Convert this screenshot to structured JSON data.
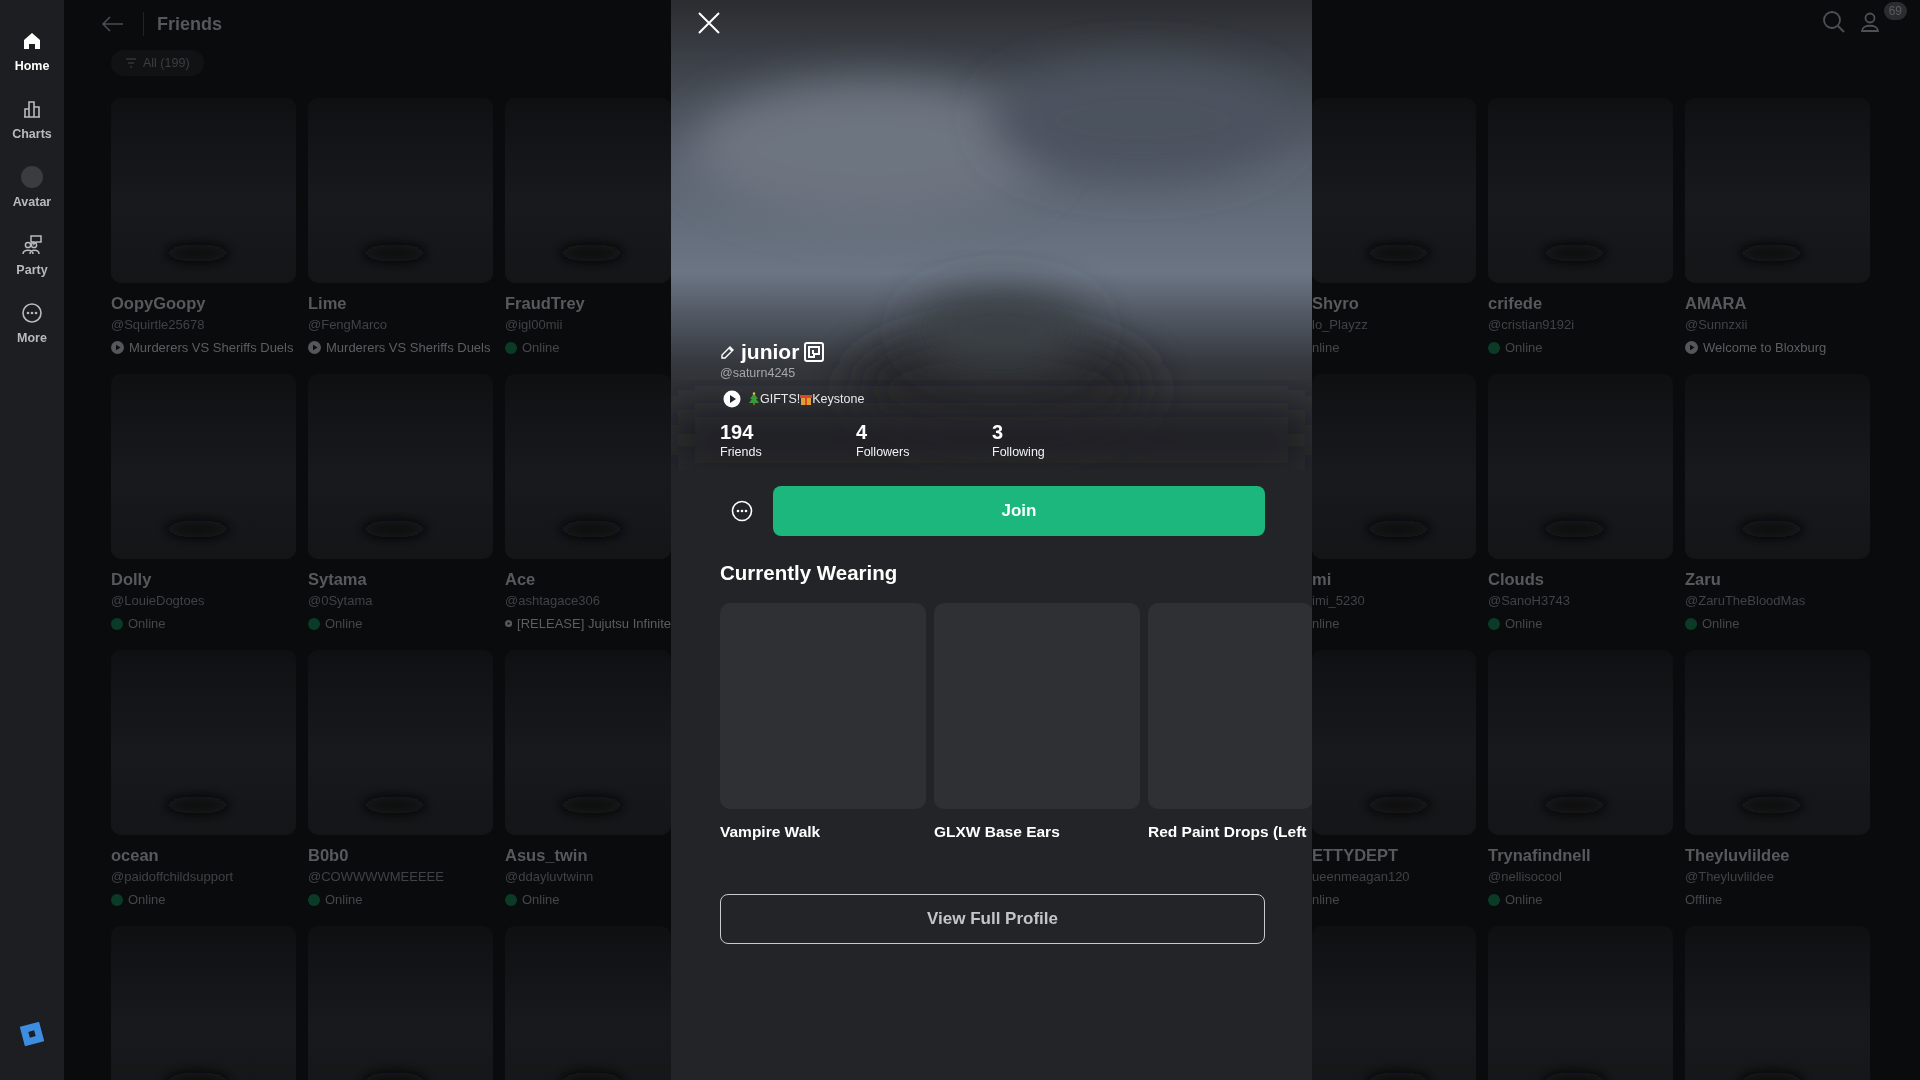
{
  "sidebar": {
    "items": [
      {
        "label": "Home",
        "selected": true
      },
      {
        "label": "Charts",
        "selected": false
      },
      {
        "label": "Avatar",
        "selected": false
      },
      {
        "label": "Party",
        "selected": false
      },
      {
        "label": "More",
        "selected": false
      }
    ]
  },
  "header": {
    "title": "Friends",
    "filter": "All (199)",
    "notifications": "69"
  },
  "friend_rows": [
    {
      "cards": [
        {
          "name": "OopyGoopy",
          "handle": "@Squirtle25678",
          "status": "Murderers VS Sheriffs Duels",
          "kind": "game"
        },
        {
          "name": "Lime",
          "handle": "@FengMarco",
          "status": "Murderers VS Sheriffs Duels",
          "kind": "game"
        },
        {
          "name": "FraudTrey",
          "handle": "@igl00mii",
          "status": "Online",
          "kind": "online"
        },
        {
          "name": "Shyro",
          "handle": "lo_Playzz",
          "status": "nline",
          "kind": "text"
        },
        {
          "name": "crifede",
          "handle": "@cristian9192i",
          "status": "Online",
          "kind": "online"
        },
        {
          "name": "AMARA",
          "handle": "@Sunnzxii",
          "status": "Welcome to Bloxburg",
          "kind": "game"
        }
      ]
    },
    {
      "cards": [
        {
          "name": "Dolly",
          "handle": "@LouieDogtoes",
          "status": "Online",
          "kind": "online"
        },
        {
          "name": "Sytama",
          "handle": "@0Sytama",
          "status": "Online",
          "kind": "online"
        },
        {
          "name": "Ace",
          "handle": "@ashtagace306",
          "status": "[RELEASE] Jujutsu Infinite",
          "kind": "game"
        },
        {
          "name": "mi",
          "handle": "imi_5230",
          "status": "nline",
          "kind": "text"
        },
        {
          "name": "Clouds",
          "handle": "@SanoH3743",
          "status": "Online",
          "kind": "online"
        },
        {
          "name": "Zaru",
          "handle": "@ZaruTheBloodMas",
          "status": "Online",
          "kind": "online"
        }
      ]
    },
    {
      "cards": [
        {
          "name": "ocean",
          "handle": "@paidoffchildsupport",
          "status": "Online",
          "kind": "online"
        },
        {
          "name": "B0b0",
          "handle": "@COWWWWMEEEEE",
          "status": "Online",
          "kind": "online"
        },
        {
          "name": "Asus_twin",
          "handle": "@ddayluvtwinn",
          "status": "Online",
          "kind": "online"
        },
        {
          "name": "ETTYDEPT",
          "handle": "ueenmeagan120",
          "status": "nline",
          "kind": "text"
        },
        {
          "name": "Trynafindnell",
          "handle": "@nellisocool",
          "status": "Online",
          "kind": "online"
        },
        {
          "name": "Theyluvlildee",
          "handle": "@Theyluvlildee",
          "status": "Offline",
          "kind": "text"
        }
      ]
    }
  ],
  "profile": {
    "display_name": "junior",
    "username": "@saturn4245",
    "experience": [
      {
        "kind": "tree"
      },
      {
        "kind": "text",
        "text": "GIFTS!"
      },
      {
        "kind": "gift"
      },
      {
        "kind": "text",
        "text": "Keystone"
      }
    ],
    "stats": [
      {
        "value": "194",
        "label": "Friends"
      },
      {
        "value": "4",
        "label": "Followers"
      },
      {
        "value": "3",
        "label": "Following"
      }
    ],
    "join_button": "Join",
    "wearing_title": "Currently Wearing",
    "wearing": [
      "Vampire Walk",
      "GLXW Base Ears",
      "Red Paint Drops (Left"
    ],
    "view_profile_button": "View Full Profile"
  }
}
